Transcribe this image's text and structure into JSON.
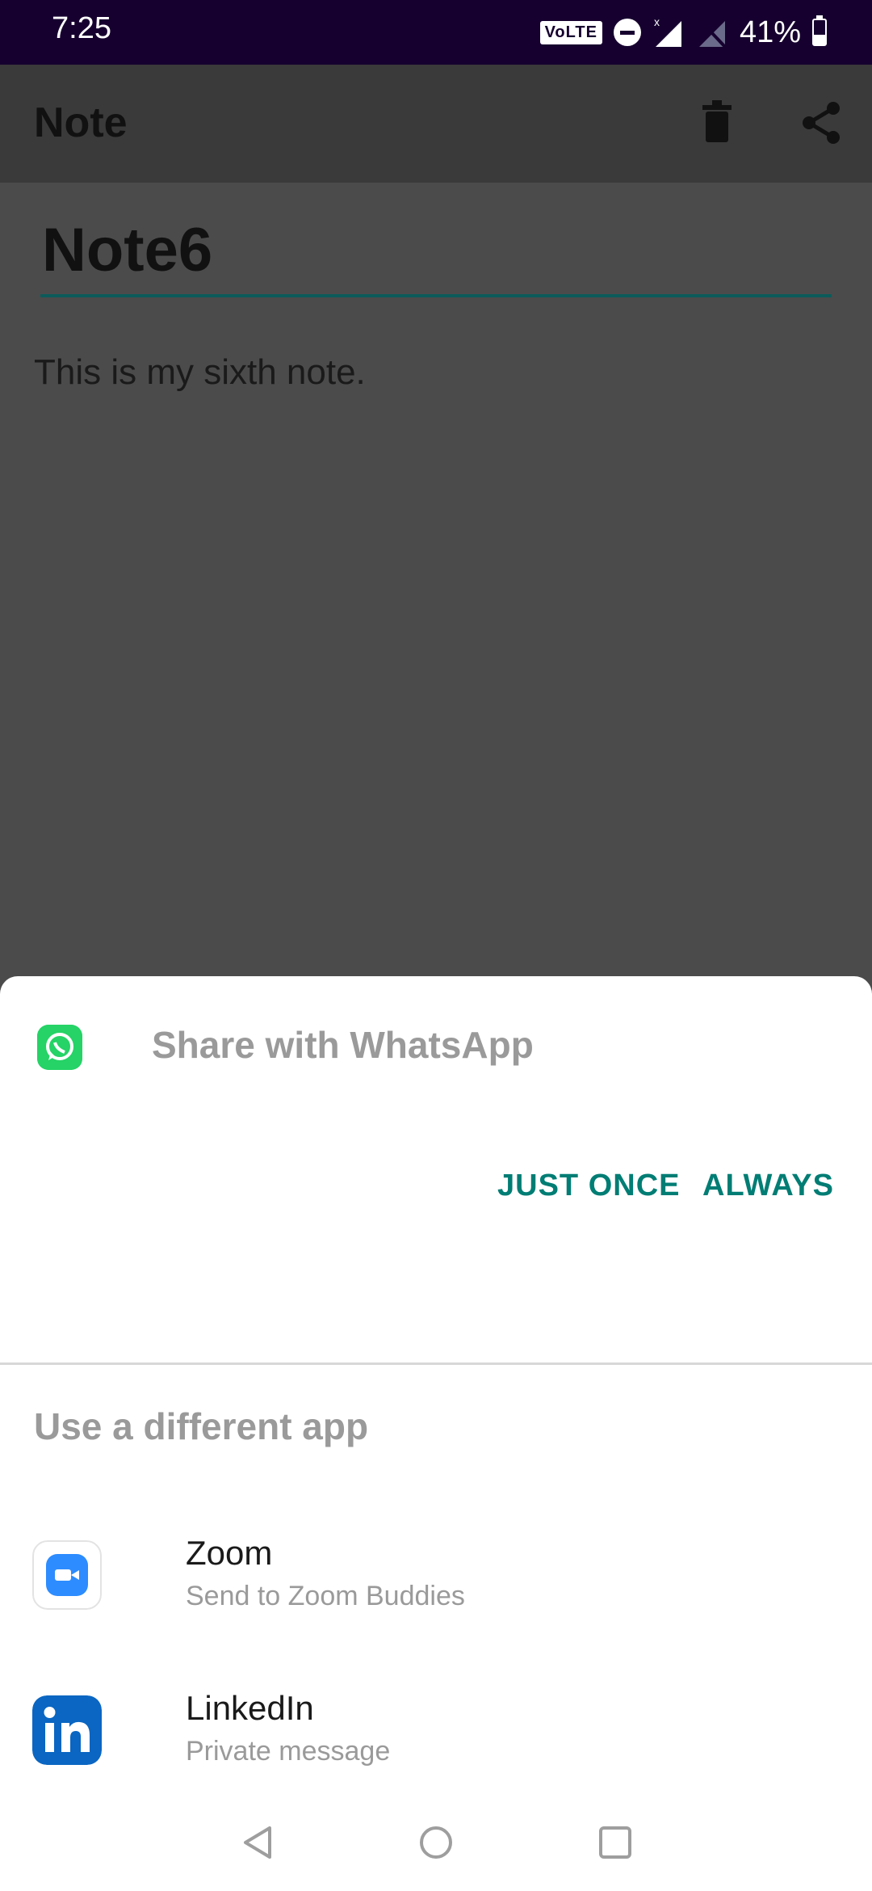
{
  "status_bar": {
    "time": "7:25",
    "volte": "VoLTE",
    "battery_percent": "41%",
    "battery_level": 0.41
  },
  "app_bar": {
    "title": "Note",
    "actions": [
      "delete-icon",
      "share-icon"
    ]
  },
  "note": {
    "title": "Note6",
    "body": "This is my sixth note."
  },
  "share_sheet": {
    "title": "Share with WhatsApp",
    "just_once_label": "JUST ONCE",
    "always_label": "ALWAYS",
    "different_app_title": "Use a different app",
    "apps": [
      {
        "name": "Zoom",
        "subtitle": "Send to Zoom Buddies",
        "icon": "zoom-icon",
        "color": "#2d8cff"
      },
      {
        "name": "LinkedIn",
        "subtitle": "Private message",
        "icon": "linkedin-icon",
        "color": "#0a66c2"
      }
    ]
  },
  "nav_bar": {
    "buttons": [
      "back-icon",
      "home-icon",
      "recents-icon"
    ]
  },
  "colors": {
    "status_bar_bg": "#16002f",
    "accent": "#007d74",
    "whatsapp": "#25d366"
  }
}
